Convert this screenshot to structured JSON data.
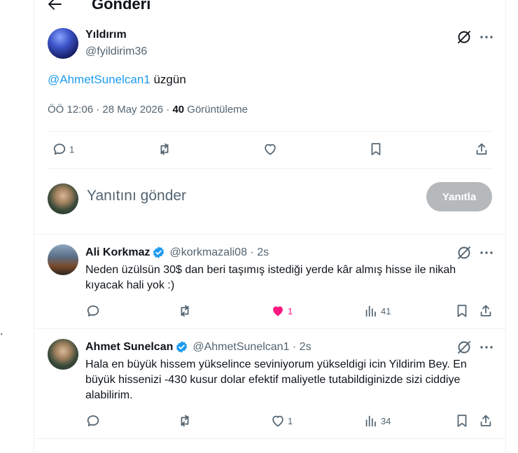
{
  "header": {
    "title": "Gönderi"
  },
  "post": {
    "author_name": "Yıldırım",
    "author_handle": "@fyildirim36",
    "mention": "@AhmetSunelcan1",
    "text": " üzgün",
    "time": "ÖÖ 12:06 · 28 May 2026 · ",
    "views": "40",
    "views_label": " Görüntüleme",
    "reply_count": "1"
  },
  "composer": {
    "placeholder": "Yanıtını gönder",
    "button_label": "Yanıtla"
  },
  "replies": [
    {
      "name": "Ali Korkmaz",
      "handle": "@korkmazali08 · 2s",
      "text": "Neden üzülsün 30$ dan beri taşımış istediği yerde kâr almış hisse ile nikah kıyacak hali yok :)",
      "likes": "1",
      "views": "41",
      "liked": true
    },
    {
      "name": "Ahmet Sunelcan",
      "handle": "@AhmetSunelcan1 · 2s",
      "text": "Hala en büyük hissem yükselince seviniyorum yükseldigi icin Yildirim Bey. En büyük hissenizi -430 kusur dolar efektif maliyetle tutabildiginizde sizi ciddiye alabilirim.",
      "likes": "1",
      "views": "34",
      "liked": false
    }
  ],
  "colors": {
    "accent": "#1d9bf0",
    "like": "#f91880",
    "muted": "#536471",
    "verified": "#1d9bf0"
  },
  "icons": [
    "back-arrow-icon",
    "grok-icon",
    "more-icon",
    "reply-icon",
    "repost-icon",
    "like-icon",
    "bookmark-icon",
    "share-icon",
    "views-icon",
    "verified-icon"
  ]
}
